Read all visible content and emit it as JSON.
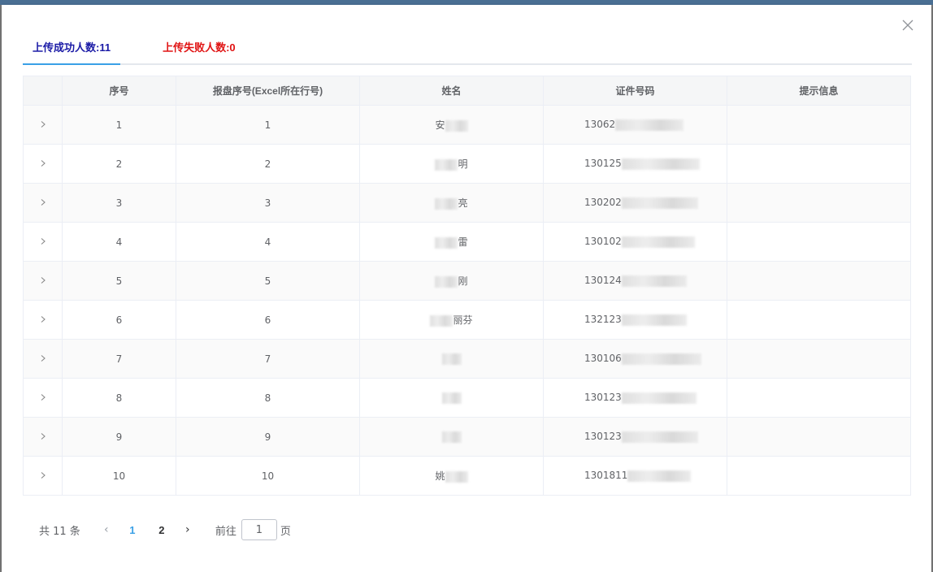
{
  "dialog": {
    "tabs": [
      {
        "label": "上传成功人数:11"
      },
      {
        "label": "上传失败人数:0"
      }
    ]
  },
  "table": {
    "headers": [
      "序号",
      "报盘序号(Excel所在行号)",
      "姓名",
      "证件号码",
      "提示信息"
    ],
    "rows": [
      {
        "seq": "1",
        "row": "1",
        "name_pre": "安",
        "name_post": "",
        "id_prefix": "13062"
      },
      {
        "seq": "2",
        "row": "2",
        "name_pre": "",
        "name_post": "明",
        "id_prefix": "130125"
      },
      {
        "seq": "3",
        "row": "3",
        "name_pre": "",
        "name_post": "亮",
        "id_prefix": "130202"
      },
      {
        "seq": "4",
        "row": "4",
        "name_pre": "",
        "name_post": "雷",
        "id_prefix": "130102"
      },
      {
        "seq": "5",
        "row": "5",
        "name_pre": "",
        "name_post": "刚",
        "id_prefix": "130124"
      },
      {
        "seq": "6",
        "row": "6",
        "name_pre": "",
        "name_post": "丽芬",
        "id_prefix": "132123"
      },
      {
        "seq": "7",
        "row": "7",
        "name_pre": "",
        "name_post": "",
        "id_prefix": "130106"
      },
      {
        "seq": "8",
        "row": "8",
        "name_pre": "",
        "name_post": "",
        "id_prefix": "130123"
      },
      {
        "seq": "9",
        "row": "9",
        "name_pre": "",
        "name_post": "",
        "id_prefix": "130123"
      },
      {
        "seq": "10",
        "row": "10",
        "name_pre": "姚",
        "name_post": "",
        "id_prefix": "1301811"
      }
    ],
    "icons": {
      "expand": "chevron-right-icon"
    }
  },
  "pagination": {
    "total_label": "共 11 条",
    "pages": [
      "1",
      "2"
    ],
    "jump_prefix": "前往",
    "jump_value": "1",
    "jump_suffix": "页"
  },
  "colors": {
    "success_tab": "#1a1aa6",
    "fail_tab": "#e01212",
    "active_accent": "#3aa0e6"
  }
}
